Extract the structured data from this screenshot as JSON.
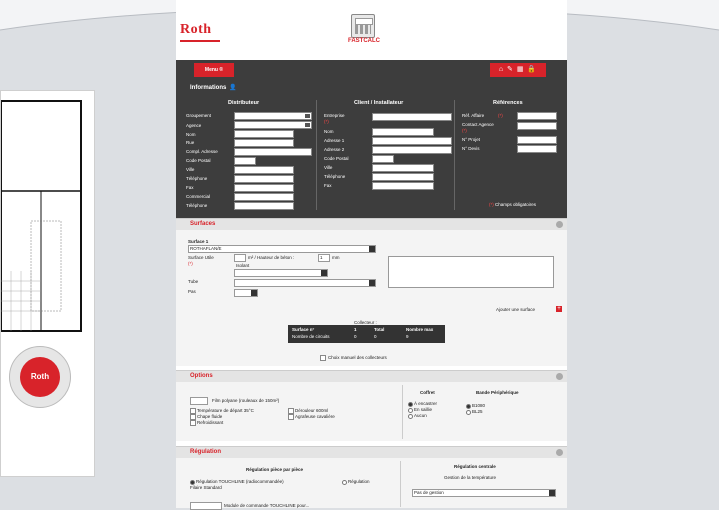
{
  "header": {
    "logo": "Roth",
    "fastcalc_label": "FASTCALC"
  },
  "toolbar": {
    "menu_label": "Menu ®",
    "tool_icons": "⌂ ✎ ▦ 🔒"
  },
  "informations": {
    "title": "Informations",
    "distributeur": {
      "heading": "Distributeur",
      "labels": [
        "Groupement",
        "Agence",
        "Nom",
        "Rue",
        "Compl. Adresse",
        "Code Postal",
        "Ville",
        "Téléphone",
        "Fax",
        "Commercial",
        "Téléphone"
      ]
    },
    "client": {
      "heading": "Client / Installateur",
      "entreprise_label": "Entreprise",
      "entreprise_req": "(*)",
      "labels": [
        "Nom",
        "Adresse 1",
        "Adresse 2",
        "Code Postal",
        "Ville",
        "Téléphone",
        "Fax"
      ]
    },
    "references": {
      "heading": "Références",
      "labels": [
        "Réf. Affaire",
        "Contact Agence",
        "N° Projet",
        "N° Devis"
      ],
      "ref_req": "(*)",
      "contact_req": "(*)"
    },
    "champs_req": "(*)",
    "champs_label": "Champs obligatoires"
  },
  "surfaces": {
    "title": "Surfaces",
    "surface_label": "Surface 1",
    "surface_type": "ROTHAFLAN/E",
    "surface_utile_label": "Surface Utile",
    "surface_utile_unit": "m² / Hauteur de béton :",
    "hauteur_value": "1",
    "hauteur_unit": "mm",
    "req": "(*)",
    "isolant_label": "Isolant",
    "tube_label": "Tube",
    "pas_label": "Pas",
    "ajouter_label": "Ajouter une surface",
    "collecteur_label": "Collecteur :",
    "collect_headers": [
      "Surface n°",
      "1",
      "Total",
      "Nombre max"
    ],
    "collect_row": [
      "Nombre de circuits",
      "0",
      "0",
      "9"
    ],
    "choix_manuel": "Choix manuel des collecteurs"
  },
  "options": {
    "title": "Options",
    "film_label": "Film polyane (rouleaux de 150m²)",
    "checkboxes": [
      "Température de départ 35°C",
      "Chape fluide",
      "Refroidissant",
      "Dérouleur 600ml",
      "Agrafeuse cavalière"
    ],
    "coffret_heading": "Coffret",
    "coffret_options": [
      "À encastrer",
      "En saillie",
      "Aucun"
    ],
    "bande_heading": "Bande Périphérique",
    "bande_options": [
      "B1080",
      "BL25"
    ]
  },
  "regulation": {
    "title": "Régulation",
    "piece_heading": "Régulation pièce par pièce",
    "piece_option1": "Régulation TOUCHLINE (radiocommandée)",
    "piece_option2": "Régulation",
    "piece_option1b": "Filaire Standard",
    "centrale_heading": "Régulation centrale",
    "gestion_label": "Gestion de la température",
    "gestion_value": "Pas de gestion",
    "module_text": "Module de commande TOUCHLINE pour..."
  }
}
